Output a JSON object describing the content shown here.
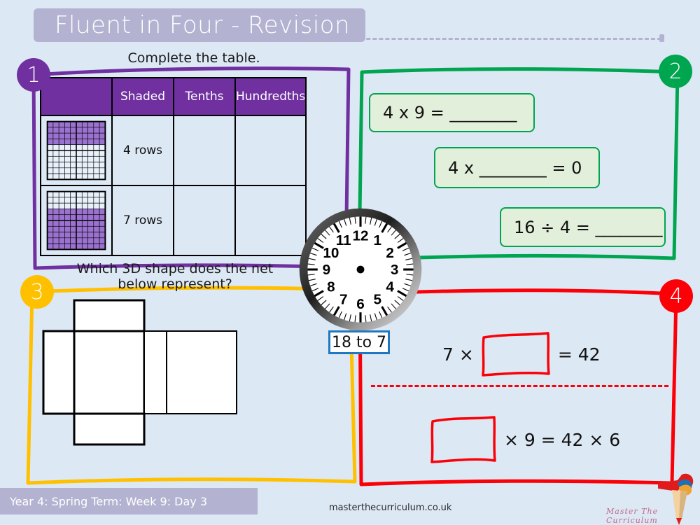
{
  "header": {
    "title": "Fluent in Four - Revision"
  },
  "footer": {
    "lesson_label": "Year 4: Spring Term: Week 9: Day 3",
    "website": "masterthecurriculum.co.uk",
    "brand": "Master The Curriculum"
  },
  "colors": {
    "background": "#dde8f5",
    "banner": "#b4b2d1",
    "section1": "#7030a0",
    "section2": "#00a550",
    "section3": "#ffc000",
    "section4": "#fb0007",
    "clock_label_border": "#1f78c1",
    "eqbox_fill": "#e2efda",
    "grid_shade": "#9c72d0"
  },
  "sections": [
    {
      "number": "1",
      "color": "#7030a0",
      "prompt": "Complete the table.",
      "table": {
        "headers": [
          "",
          "Shaded",
          "Tenths",
          "Hundredths"
        ],
        "rows": [
          {
            "grid_shaded_rows": 4,
            "grid_shade_from": "top",
            "shaded": "4 rows",
            "tenths": "",
            "hundredths": ""
          },
          {
            "grid_shaded_rows": 7,
            "grid_shade_from": "bottom",
            "shaded": "7 rows",
            "tenths": "",
            "hundredths": ""
          }
        ]
      }
    },
    {
      "number": "2",
      "color": "#00a550",
      "equations": [
        "4 x 9 = ________",
        "4 x ________ = 0",
        "16 ÷ 4 = ________"
      ]
    },
    {
      "number": "3",
      "color": "#ffc000",
      "prompt": "Which 3D shape does the net below represent?",
      "net": {
        "type": "cuboid-net",
        "faces": 6
      }
    },
    {
      "number": "4",
      "color": "#fb0007",
      "problems": [
        {
          "before": "7 ×",
          "box": "",
          "after": "= 42"
        },
        {
          "before": "",
          "box": "",
          "after": "× 9 = 42 × 6"
        }
      ]
    }
  ],
  "clock": {
    "label": "18 to 7",
    "numerals": [
      "12",
      "1",
      "2",
      "3",
      "4",
      "5",
      "6",
      "7",
      "8",
      "9",
      "10",
      "11"
    ],
    "hands_shown": false
  }
}
